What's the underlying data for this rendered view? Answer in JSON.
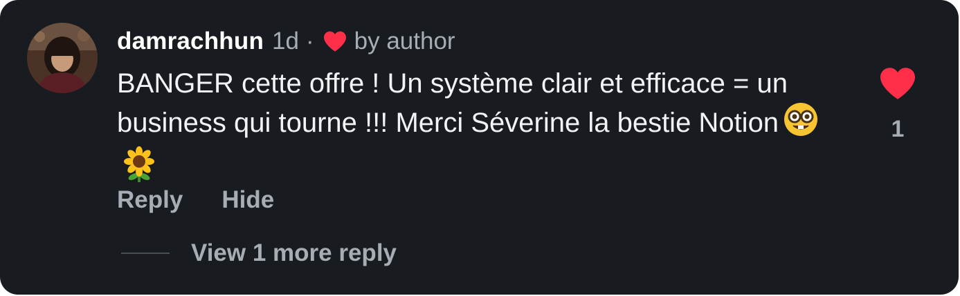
{
  "comment": {
    "username": "damrachhun",
    "time_ago": "1d",
    "separator": "·",
    "liked_by": "by author",
    "text": "BANGER cette offre ! Un système clair et efficace = un business qui tourne !!! Merci Séverine la bestie Notion",
    "emojis": [
      "nerd-face-emoji",
      "sunflower-emoji"
    ],
    "like_count": "1",
    "liked": true
  },
  "actions": {
    "reply_label": "Reply",
    "hide_label": "Hide"
  },
  "replies": {
    "view_more_label": "View 1 more reply"
  },
  "colors": {
    "background": "#181c20",
    "heart": "#ff2f4a",
    "muted_text": "#a8acb5",
    "primary_text": "#f2f3f5"
  }
}
